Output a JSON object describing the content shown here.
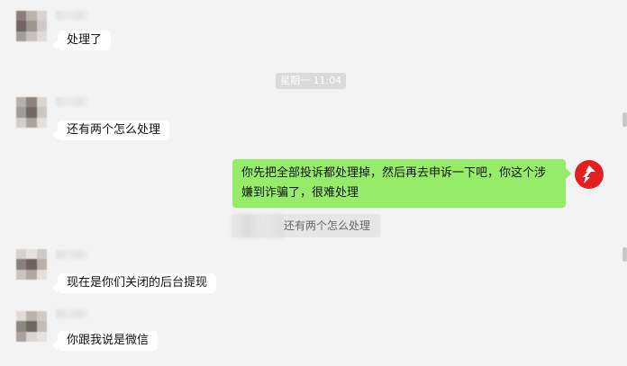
{
  "messages": [
    {
      "text": "处理了"
    },
    {
      "text": "还有两个怎么处理"
    },
    {
      "text": "你先把全部投诉都处理掉，然后再去申诉一下吧，你这个涉嫌到诈骗了，很难处理"
    },
    {
      "text": "现在是你们关闭的后台提现"
    },
    {
      "text": "你跟我说是微信"
    }
  ],
  "timestamp": "星期一 11:04",
  "quote": {
    "text": "还有两个怎么处理"
  },
  "colors": {
    "background": "#f3f3f3",
    "incoming_bubble": "#ffffff",
    "outgoing_bubble": "#95ec69",
    "self_avatar_red": "#e41f1f"
  },
  "icons": {
    "self_avatar": "red-s-logo-icon"
  }
}
